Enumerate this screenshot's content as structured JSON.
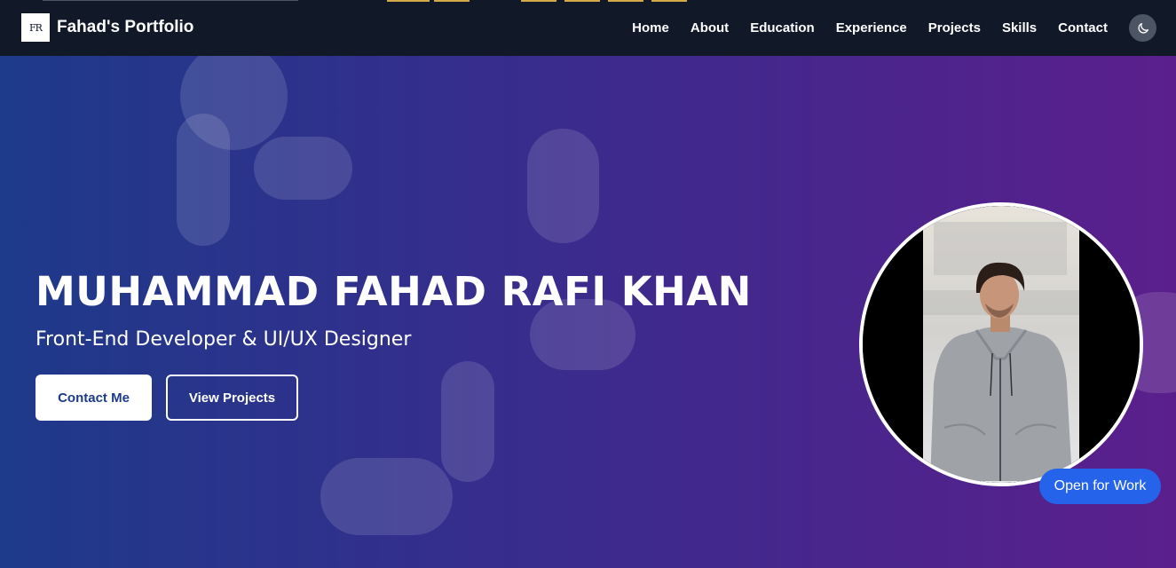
{
  "brand": {
    "logo_text": "FR",
    "title": "Fahad's Portfolio"
  },
  "nav": {
    "items": [
      {
        "label": "Home"
      },
      {
        "label": "About"
      },
      {
        "label": "Education"
      },
      {
        "label": "Experience"
      },
      {
        "label": "Projects"
      },
      {
        "label": "Skills"
      },
      {
        "label": "Contact"
      }
    ],
    "theme_icon": "moon-icon"
  },
  "hero": {
    "name": "MUHAMMAD FAHAD RAFI KHAN",
    "subtitle": "Front-End Developer & UI/UX Designer",
    "contact_button": "Contact Me",
    "projects_button": "View Projects",
    "status_badge": "Open for Work"
  },
  "colors": {
    "navbar": "#111827",
    "gradient_start": "#1e3a8a",
    "gradient_end": "#5b1f8c",
    "badge": "#2563eb",
    "accent_text": "#1e3a8a"
  }
}
